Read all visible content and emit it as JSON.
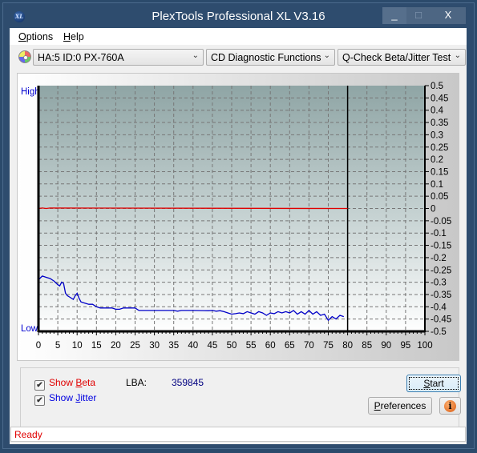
{
  "window": {
    "title": "PlexTools Professional XL V3.16",
    "app_icon_text": "XL",
    "minimize_glyph": "_",
    "maximize_glyph": "□",
    "close_glyph": "X"
  },
  "menu": {
    "items": [
      {
        "label": "Options",
        "accel": "O",
        "rest": "ptions"
      },
      {
        "label": "Help",
        "accel": "H",
        "rest": "elp"
      }
    ]
  },
  "toolbar": {
    "drive_select": {
      "value": "HA:5 ID:0  PX-760A",
      "icon": "cd-drive-icon"
    },
    "function_select": {
      "value": "CD Diagnostic Functions"
    },
    "test_select": {
      "value": "Q-Check Beta/Jitter Test"
    },
    "chevron": "⌄"
  },
  "chart_data": {
    "type": "line",
    "title": "",
    "xlabel": "",
    "ylabel": "",
    "left_labels": {
      "top": "High",
      "bottom": "Low"
    },
    "xlim": [
      0,
      100
    ],
    "ylim": [
      -0.5,
      0.5
    ],
    "x_ticks": [
      0,
      5,
      10,
      15,
      20,
      25,
      30,
      35,
      40,
      45,
      50,
      55,
      60,
      65,
      70,
      75,
      80,
      85,
      90,
      95,
      100
    ],
    "y_ticks": [
      0.5,
      0.45,
      0.4,
      0.35,
      0.3,
      0.25,
      0.2,
      0.15,
      0.1,
      0.05,
      0,
      -0.05,
      -0.1,
      -0.15,
      -0.2,
      -0.25,
      -0.3,
      -0.35,
      -0.4,
      -0.45,
      -0.5
    ],
    "y_tick_labels": [
      "0.5",
      "0.45",
      "0.4",
      "0.35",
      "0.3",
      "0.25",
      "0.2",
      "0.15",
      "0.1",
      "0.05",
      "0",
      "-0.05",
      "-0.1",
      "-0.15",
      "-0.2",
      "-0.25",
      "-0.3",
      "-0.35",
      "-0.4",
      "-0.45",
      "-0.5"
    ],
    "grid": true,
    "end_marker_x": 80,
    "series": [
      {
        "name": "Beta",
        "color": "#e00000",
        "x": [
          0,
          1,
          2,
          3,
          80
        ],
        "y": [
          0.0,
          0.002,
          0.0,
          0.002,
          0.0
        ]
      },
      {
        "name": "Jitter",
        "color": "#0000c8",
        "x": [
          0,
          1,
          2,
          3,
          4,
          5,
          5.5,
          6,
          6.5,
          7,
          7.5,
          8,
          9,
          9.5,
          10,
          10.5,
          11,
          12,
          13,
          14,
          15,
          16,
          17,
          18,
          19,
          20,
          21,
          22,
          23,
          24,
          25,
          26,
          30,
          35,
          36,
          37,
          40,
          44,
          45,
          46,
          47,
          48,
          49,
          50,
          51,
          52,
          53,
          54,
          55,
          56,
          57,
          58,
          59,
          60,
          61,
          62,
          63,
          64,
          65,
          66,
          67,
          68,
          69,
          70,
          71,
          72,
          73,
          74,
          75,
          76,
          77,
          78,
          79
        ],
        "y": [
          -0.29,
          -0.275,
          -0.28,
          -0.285,
          -0.295,
          -0.31,
          -0.315,
          -0.3,
          -0.305,
          -0.345,
          -0.355,
          -0.36,
          -0.37,
          -0.355,
          -0.345,
          -0.365,
          -0.38,
          -0.385,
          -0.39,
          -0.39,
          -0.4,
          -0.405,
          -0.405,
          -0.405,
          -0.405,
          -0.41,
          -0.41,
          -0.405,
          -0.405,
          -0.405,
          -0.405,
          -0.415,
          -0.415,
          -0.415,
          -0.418,
          -0.415,
          -0.415,
          -0.416,
          -0.415,
          -0.418,
          -0.416,
          -0.42,
          -0.425,
          -0.43,
          -0.428,
          -0.425,
          -0.428,
          -0.42,
          -0.425,
          -0.43,
          -0.42,
          -0.425,
          -0.435,
          -0.425,
          -0.428,
          -0.42,
          -0.425,
          -0.42,
          -0.425,
          -0.415,
          -0.43,
          -0.42,
          -0.43,
          -0.415,
          -0.43,
          -0.42,
          -0.435,
          -0.43,
          -0.455,
          -0.44,
          -0.45,
          -0.435,
          -0.44
        ]
      }
    ]
  },
  "controls": {
    "show_beta": {
      "label_pre": "Show ",
      "accel": "B",
      "label_post": "eta",
      "checked": true
    },
    "show_jitter": {
      "label_pre": "Show ",
      "accel": "J",
      "label_post": "itter",
      "checked": true
    },
    "check_glyph": "✔",
    "lba_label": "LBA:",
    "lba_value": "359845",
    "start_button": {
      "accel": "S",
      "rest": "tart"
    },
    "preferences_button": {
      "accel": "P",
      "rest": "references"
    },
    "info_glyph": "i"
  },
  "status": {
    "text": "Ready",
    "color": "#e00000"
  }
}
